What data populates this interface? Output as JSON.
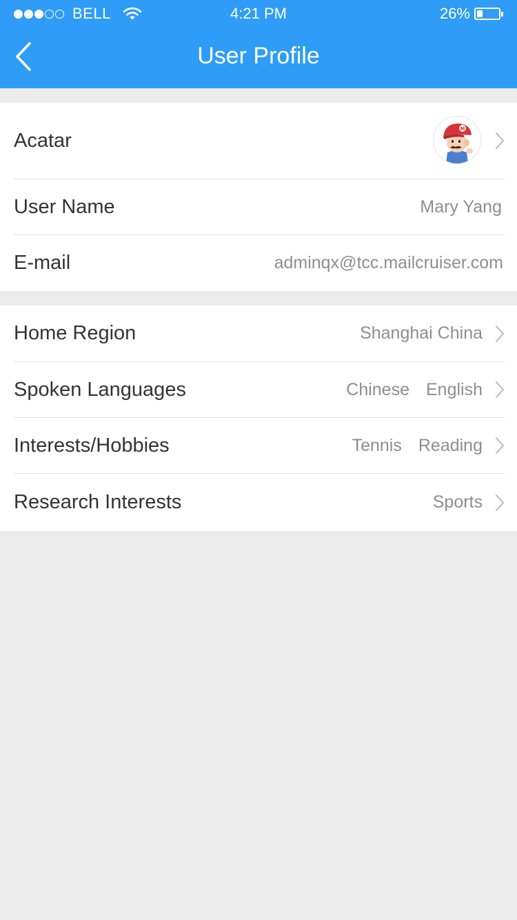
{
  "status_bar": {
    "signal_dots_filled": 3,
    "signal_dots_total": 5,
    "carrier": "BELL",
    "time": "4:21 PM",
    "battery_percent": "26%",
    "battery_level": 0.26
  },
  "nav": {
    "title": "User Profile",
    "back_icon": "chevron-left-icon"
  },
  "colors": {
    "header_bg": "#2f9cf7",
    "page_bg": "#ececec",
    "label_text": "#333333",
    "value_text": "#8e8e8e"
  },
  "profile": {
    "avatar_label": "Acatar",
    "username_label": "User Name",
    "username_value": "Mary Yang",
    "email_label": "E-mail",
    "email_value": "adminqx@tcc.mailcruiser.com"
  },
  "details": {
    "home_region_label": "Home Region",
    "home_region_value": "Shanghai China",
    "languages_label": "Spoken Languages",
    "languages": [
      "Chinese",
      "English"
    ],
    "hobbies_label": "Interests/Hobbies",
    "hobbies": [
      "Tennis",
      "Reading"
    ],
    "research_label": "Research Interests",
    "research_value": "Sports"
  }
}
